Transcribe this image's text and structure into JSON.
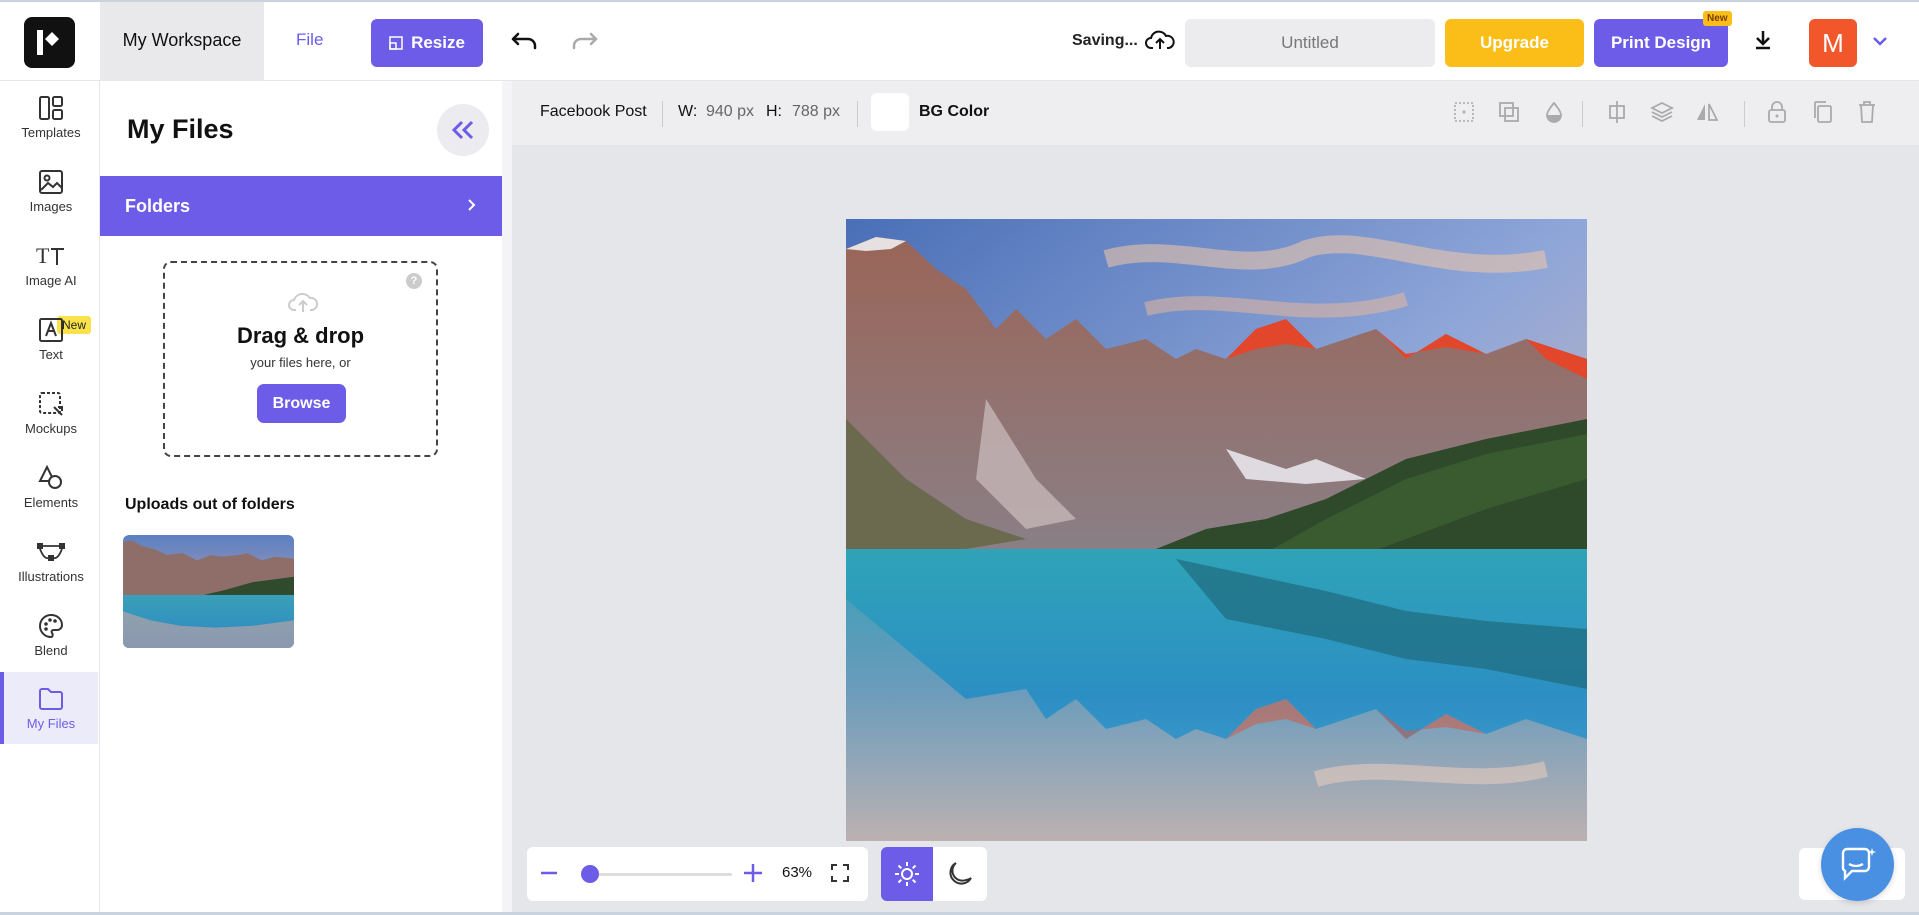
{
  "colors": {
    "accent": "#6c5ce7",
    "upgrade": "#fbbd17",
    "avatar": "#f2562b",
    "new_badge": "#fbe14a"
  },
  "header": {
    "workspace_label": "My Workspace",
    "file_label": "File",
    "resize_label": "Resize",
    "saving_text": "Saving...",
    "doc_title": "Untitled",
    "upgrade_label": "Upgrade",
    "print_label": "Print Design",
    "print_badge": "New",
    "avatar_letter": "M"
  },
  "sidebar": {
    "items": [
      {
        "label": "Templates",
        "icon": "templates-icon"
      },
      {
        "label": "Images",
        "icon": "image-icon"
      },
      {
        "label": "Image AI",
        "icon": "image-ai-icon",
        "badge": "New"
      },
      {
        "label": "Text",
        "icon": "text-icon"
      },
      {
        "label": "Mockups",
        "icon": "mockups-icon"
      },
      {
        "label": "Elements",
        "icon": "elements-icon"
      },
      {
        "label": "Illustrations",
        "icon": "illustrations-icon"
      },
      {
        "label": "Blend",
        "icon": "palette-icon"
      },
      {
        "label": "My Files",
        "icon": "folder-icon",
        "active": true
      }
    ]
  },
  "panel": {
    "title": "My Files",
    "folders_label": "Folders",
    "dropzone": {
      "title": "Drag & drop",
      "subtitle": "your files here, or",
      "browse_label": "Browse",
      "help": "?"
    },
    "uploads_label": "Uploads out of folders"
  },
  "toolbar": {
    "format": "Facebook Post",
    "width_label": "W:",
    "width_value": "940 px",
    "height_label": "H:",
    "height_value": "788 px",
    "bg_label": "BG Color"
  },
  "zoom": {
    "percent": "63%",
    "level": 0.05
  }
}
